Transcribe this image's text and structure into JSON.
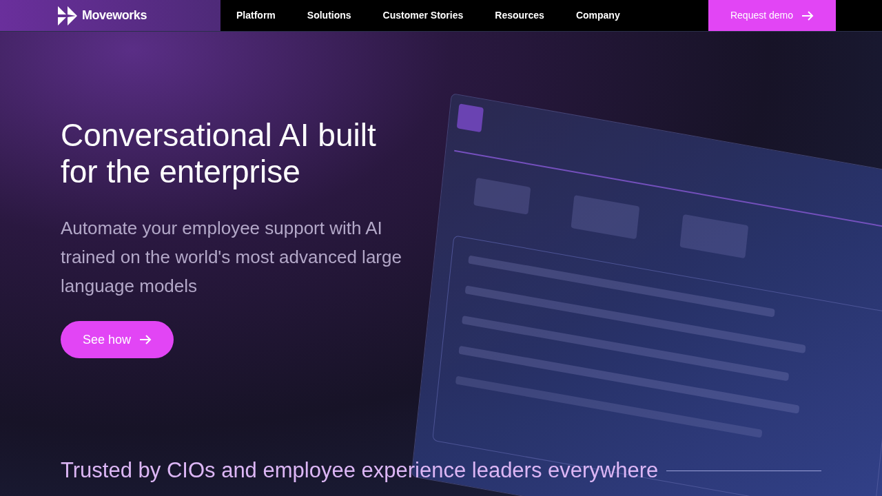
{
  "header": {
    "logo": "Moveworks",
    "nav": [
      {
        "label": "Platform"
      },
      {
        "label": "Solutions"
      },
      {
        "label": "Customer Stories"
      },
      {
        "label": "Resources"
      },
      {
        "label": "Company"
      }
    ],
    "cta": "Request demo"
  },
  "hero": {
    "title": "Conversational AI built for the enterprise",
    "subtitle": "Automate your employee support with AI trained on the world's most advanced large language models",
    "button": "See how"
  },
  "trusted": "Trusted by CIOs and employee experience leaders everywhere"
}
